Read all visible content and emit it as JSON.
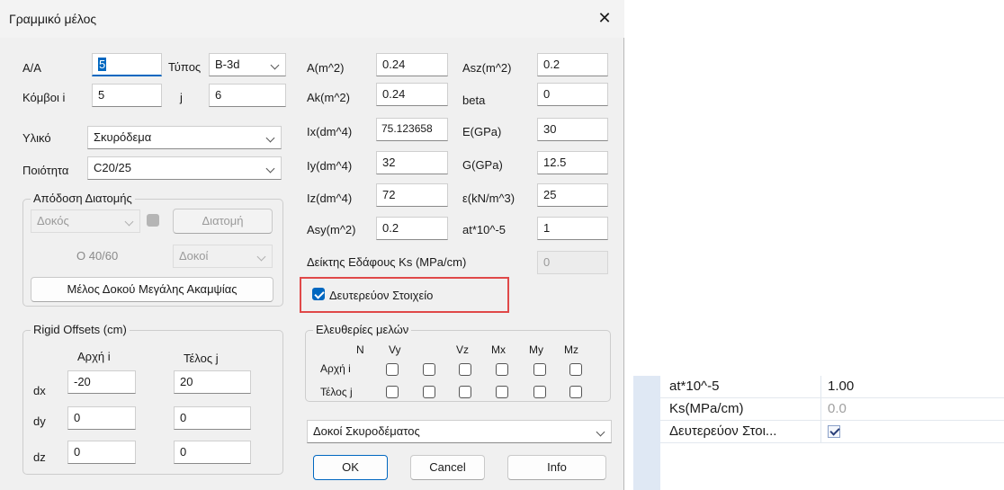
{
  "dialog": {
    "title": "Γραμμικό μέλος",
    "close_glyph": "✕",
    "aa": {
      "label": "Α/Α",
      "value_selected": "5"
    },
    "type": {
      "label": "Τύπος",
      "value": "B-3d"
    },
    "nodes": {
      "label": "Κόμβοι i",
      "i_value": "5",
      "j_label": "j",
      "j_value": "6"
    },
    "material": {
      "label": "Υλικό",
      "value": "Σκυρόδεμα"
    },
    "quality": {
      "label": "Ποιότητα",
      "value": "C20/25"
    },
    "section_group": {
      "legend": "Απόδοση Διατομής",
      "member_type": "Δοκός",
      "section_button": "Διατομή",
      "section_value": "O 40/60",
      "beams_combo": "Δοκοί",
      "deep_beam_button": "Μέλος Δοκού Μεγάλης Ακαμψίας"
    },
    "rigid": {
      "legend": "Rigid Offsets (cm)",
      "start_header": "Αρχή i",
      "end_header": "Τέλος j",
      "rows": [
        {
          "label": "dx",
          "start": "-20",
          "end": "20"
        },
        {
          "label": "dy",
          "start": "0",
          "end": "0"
        },
        {
          "label": "dz",
          "start": "0",
          "end": "0"
        }
      ]
    },
    "props_left": [
      {
        "label": "A(m^2)",
        "value": "0.24"
      },
      {
        "label": "Ak(m^2)",
        "value": "0.24"
      },
      {
        "label": "Ix(dm^4)",
        "value": "75.123658"
      },
      {
        "label": "Iy(dm^4)",
        "value": "32"
      },
      {
        "label": "Iz(dm^4)",
        "value": "72"
      },
      {
        "label": "Asy(m^2)",
        "value": "0.2"
      }
    ],
    "props_right": [
      {
        "label": "Asz(m^2)",
        "value": "0.2"
      },
      {
        "label": "beta",
        "value": "0"
      },
      {
        "label": "E(GPa)",
        "value": "30"
      },
      {
        "label": "G(GPa)",
        "value": "12.5"
      },
      {
        "label": "ε(kN/m^3)",
        "value": "25"
      },
      {
        "label": "at*10^-5",
        "value": "1"
      }
    ],
    "soil": {
      "label": "Δείκτης Εδάφους Ks (MPa/cm)",
      "value": "0"
    },
    "secondary": {
      "label": "Δευτερεύον Στοιχείο",
      "checked": true
    },
    "releases": {
      "legend": "Ελευθερίες μελών",
      "columns": [
        "N",
        "Vy",
        "Vz",
        "Mx",
        "My",
        "Mz"
      ],
      "start_label": "Αρχή i",
      "end_label": "Τέλος j"
    },
    "category_combo": "Δοκοί Σκυροδέματος",
    "buttons": {
      "ok": "OK",
      "cancel": "Cancel",
      "info": "Info"
    }
  },
  "property_panel": {
    "rows": [
      {
        "name": "at*10^-5",
        "value": "1.00"
      },
      {
        "name": "Ks(MPa/cm)",
        "value": "0.0"
      },
      {
        "name": "Δευτερεύον Στοι...",
        "value": "checked"
      }
    ]
  }
}
